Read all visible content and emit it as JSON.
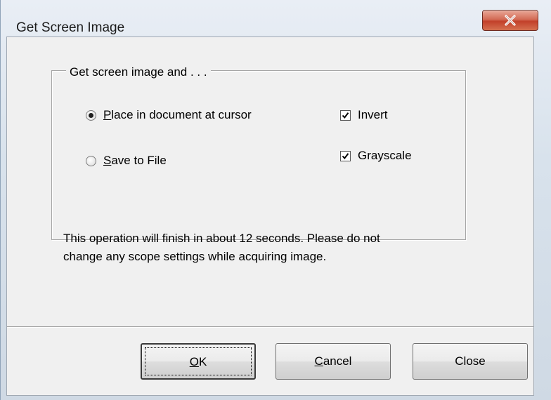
{
  "window": {
    "title": "Get Screen Image",
    "close_icon": "close-x-icon"
  },
  "group": {
    "legend": "Get screen image and . . ."
  },
  "options": {
    "place_mnemonic": "P",
    "place_rest": "lace in document at cursor",
    "place_selected": true,
    "save_mnemonic": "S",
    "save_rest": "ave to File",
    "save_selected": false,
    "invert_label": "Invert",
    "invert_checked": true,
    "grayscale_label": "Grayscale",
    "grayscale_checked": true
  },
  "message": {
    "line1": "This operation will finish in about 12 seconds. Please do not",
    "line2": "change any scope settings while acquiring image."
  },
  "buttons": {
    "ok_mnemonic": "O",
    "ok_rest": "K",
    "cancel_mnemonic": "C",
    "cancel_rest": "ancel",
    "close_label": "Close"
  },
  "colors": {
    "close_button": "#c94b33",
    "client_background": "#f0f0f0"
  }
}
